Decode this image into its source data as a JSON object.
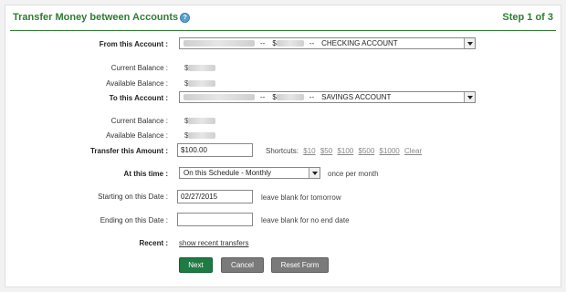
{
  "header": {
    "title": "Transfer Money between Accounts",
    "help_icon": "question-circle-icon",
    "step": "Step 1 of 3"
  },
  "from": {
    "label": "From this Account :",
    "selected_sep1": "--",
    "selected_dollar": "$",
    "selected_sep2": "--",
    "selected_type": "CHECKING ACCOUNT",
    "current_label": "Current Balance :",
    "current_value": "$",
    "available_label": "Available Balance :",
    "available_value": "$"
  },
  "to": {
    "label": "To this Account :",
    "selected_sep1": "--",
    "selected_dollar": "$",
    "selected_sep2": "--",
    "selected_type": "SAVINGS ACCOUNT",
    "current_label": "Current Balance :",
    "current_value": "$",
    "available_label": "Available Balance :",
    "available_value": "$"
  },
  "amount": {
    "label": "Transfer this Amount :",
    "value": "$100.00",
    "shortcuts_label": "Shortcuts:",
    "shortcuts": [
      "$10",
      "$50",
      "$100",
      "$500",
      "$1000",
      "Clear"
    ]
  },
  "schedule": {
    "label": "At this time :",
    "selected": "On this Schedule - Monthly",
    "note": "once per month"
  },
  "start": {
    "label": "Starting on this Date :",
    "value": "02/27/2015",
    "note": "leave blank for tomorrow"
  },
  "end": {
    "label": "Ending on this Date :",
    "value": "",
    "note": "leave blank for no end date"
  },
  "recent": {
    "label": "Recent :",
    "link": "show recent transfers"
  },
  "buttons": {
    "next": "Next",
    "cancel": "Cancel",
    "reset": "Reset Form"
  },
  "colors": {
    "accent": "#2e7d32",
    "next_button": "#1e7b43",
    "secondary_button": "#7a7a7a"
  }
}
